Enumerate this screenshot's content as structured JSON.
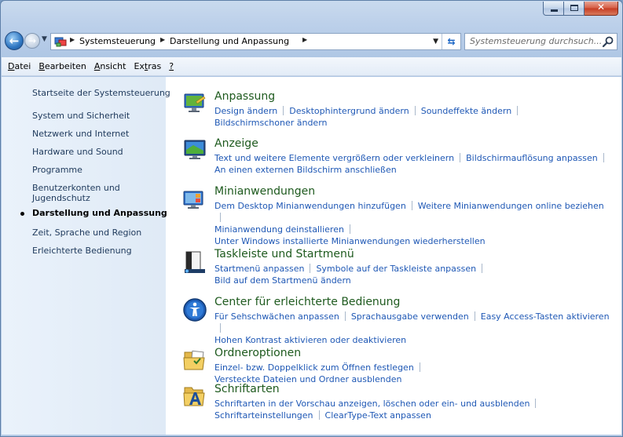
{
  "window": {
    "caption": {
      "minimize_glyph": "",
      "close_glyph": "✕"
    }
  },
  "navbar": {
    "breadcrumbs": [
      "Systemsteuerung",
      "Darstellung und Anpassung"
    ],
    "search_placeholder": "Systemsteuerung durchsuch..."
  },
  "menu": [
    {
      "label": "Datei",
      "accel": "D"
    },
    {
      "label": "Bearbeiten",
      "accel": "B"
    },
    {
      "label": "Ansicht",
      "accel": "A"
    },
    {
      "label": "Extras",
      "accel": "t"
    },
    {
      "label": "?",
      "accel": "?"
    }
  ],
  "sidebar": {
    "home": "Startseite der Systemsteuerung",
    "items": [
      "System und Sicherheit",
      "Netzwerk und Internet",
      "Hardware und Sound",
      "Programme",
      "Benutzerkonten und Jugendschutz",
      "Darstellung und Anpassung",
      "Zeit, Sprache und Region",
      "Erleichterte Bedienung"
    ],
    "current_index": 5
  },
  "categories": [
    {
      "icon": "personalization-icon",
      "title": "Anpassung",
      "lines": [
        [
          "Design ändern",
          "Desktophintergrund ändern",
          "Soundeffekte ändern",
          ""
        ],
        [
          "Bildschirmschoner ändern"
        ]
      ]
    },
    {
      "icon": "display-icon",
      "title": "Anzeige",
      "lines": [
        [
          "Text und weitere Elemente vergrößern oder verkleinern",
          "Bildschirmauflösung anpassen",
          ""
        ],
        [
          "An einen externen Bildschirm anschließen"
        ]
      ]
    },
    {
      "icon": "gadgets-icon",
      "title": "Minianwendungen",
      "lines": [
        [
          "Dem Desktop Minianwendungen hinzufügen",
          "Weitere Minianwendungen online beziehen",
          ""
        ],
        [
          "Minianwendung deinstallieren",
          ""
        ],
        [
          "Unter Windows installierte Minianwendungen wiederherstellen"
        ]
      ]
    },
    {
      "icon": "taskbar-icon",
      "title": "Taskleiste und Startmenü",
      "lines": [
        [
          "Startmenü anpassen",
          "Symbole auf der Taskleiste anpassen",
          ""
        ],
        [
          "Bild auf dem Startmenü ändern"
        ]
      ]
    },
    {
      "icon": "ease-of-access-icon",
      "title": "Center für erleichterte Bedienung",
      "lines": [
        [
          "Für Sehschwächen anpassen",
          "Sprachausgabe verwenden",
          "Easy Access-Tasten aktivieren",
          ""
        ],
        [
          "Hohen Kontrast aktivieren oder deaktivieren"
        ]
      ]
    },
    {
      "icon": "folder-options-icon",
      "title": "Ordneroptionen",
      "lines": [
        [
          "Einzel- bzw. Doppelklick zum Öffnen festlegen",
          "Versteckte Dateien und Ordner ausblenden"
        ]
      ]
    },
    {
      "icon": "fonts-icon",
      "title": "Schriftarten",
      "lines": [
        [
          "Schriftarten in der Vorschau anzeigen, löschen oder ein- und ausblenden",
          ""
        ],
        [
          "Schriftarteinstellungen",
          "ClearType-Text anpassen"
        ]
      ]
    }
  ]
}
